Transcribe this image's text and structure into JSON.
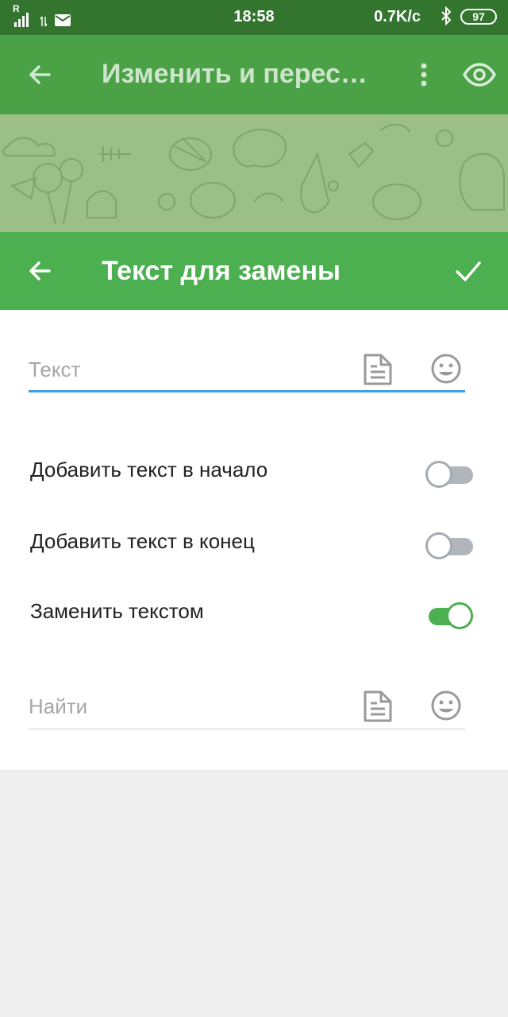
{
  "status_bar": {
    "signal": "R",
    "time": "18:58",
    "speed": "0.7K/c",
    "battery": "97"
  },
  "top_bar": {
    "title": "Изменить и перес…",
    "icons": [
      "arrow-back-icon",
      "more-vert-icon",
      "eye-icon"
    ]
  },
  "dialog": {
    "title": "Текст для замены",
    "text_field": {
      "placeholder": "Текст",
      "value": ""
    },
    "options": [
      {
        "label": "Добавить текст в начало",
        "checked": false
      },
      {
        "label": "Добавить текст в конец",
        "checked": false
      },
      {
        "label": "Заменить текстом",
        "checked": true
      }
    ],
    "find_field": {
      "placeholder": "Найти",
      "value": ""
    }
  },
  "colors": {
    "status_bar": "#33752f",
    "top_bar": "#4aa146",
    "dialog_bar": "#4caf50",
    "accent_underline": "#3ea0e0",
    "switch_on": "#4caf50",
    "switch_off": "#b0b6bb"
  }
}
